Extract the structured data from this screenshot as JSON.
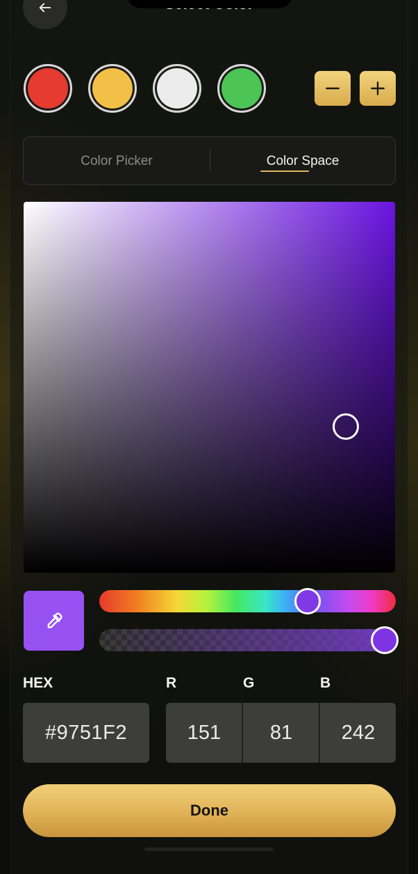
{
  "header": {
    "title": "Select Color",
    "back_icon": "arrow-left-icon"
  },
  "swatches": [
    {
      "color": "#e53b31"
    },
    {
      "color": "#f2c046"
    },
    {
      "color": "#ececec"
    },
    {
      "color": "#4cc456"
    }
  ],
  "swatch_controls": {
    "remove_icon": "minus-icon",
    "add_icon": "plus-icon"
  },
  "tabs": [
    {
      "label": "Color Picker",
      "active": false
    },
    {
      "label": "Color Space",
      "active": true
    }
  ],
  "picker": {
    "current_color": "#9751F2",
    "eyedropper_icon": "eyedropper-icon"
  },
  "inputs": {
    "hex_label": "HEX",
    "hex_value": "#9751F2",
    "r_label": "R",
    "g_label": "G",
    "b_label": "B",
    "r_value": "151",
    "g_value": "81",
    "b_value": "242"
  },
  "actions": {
    "done_label": "Done"
  }
}
